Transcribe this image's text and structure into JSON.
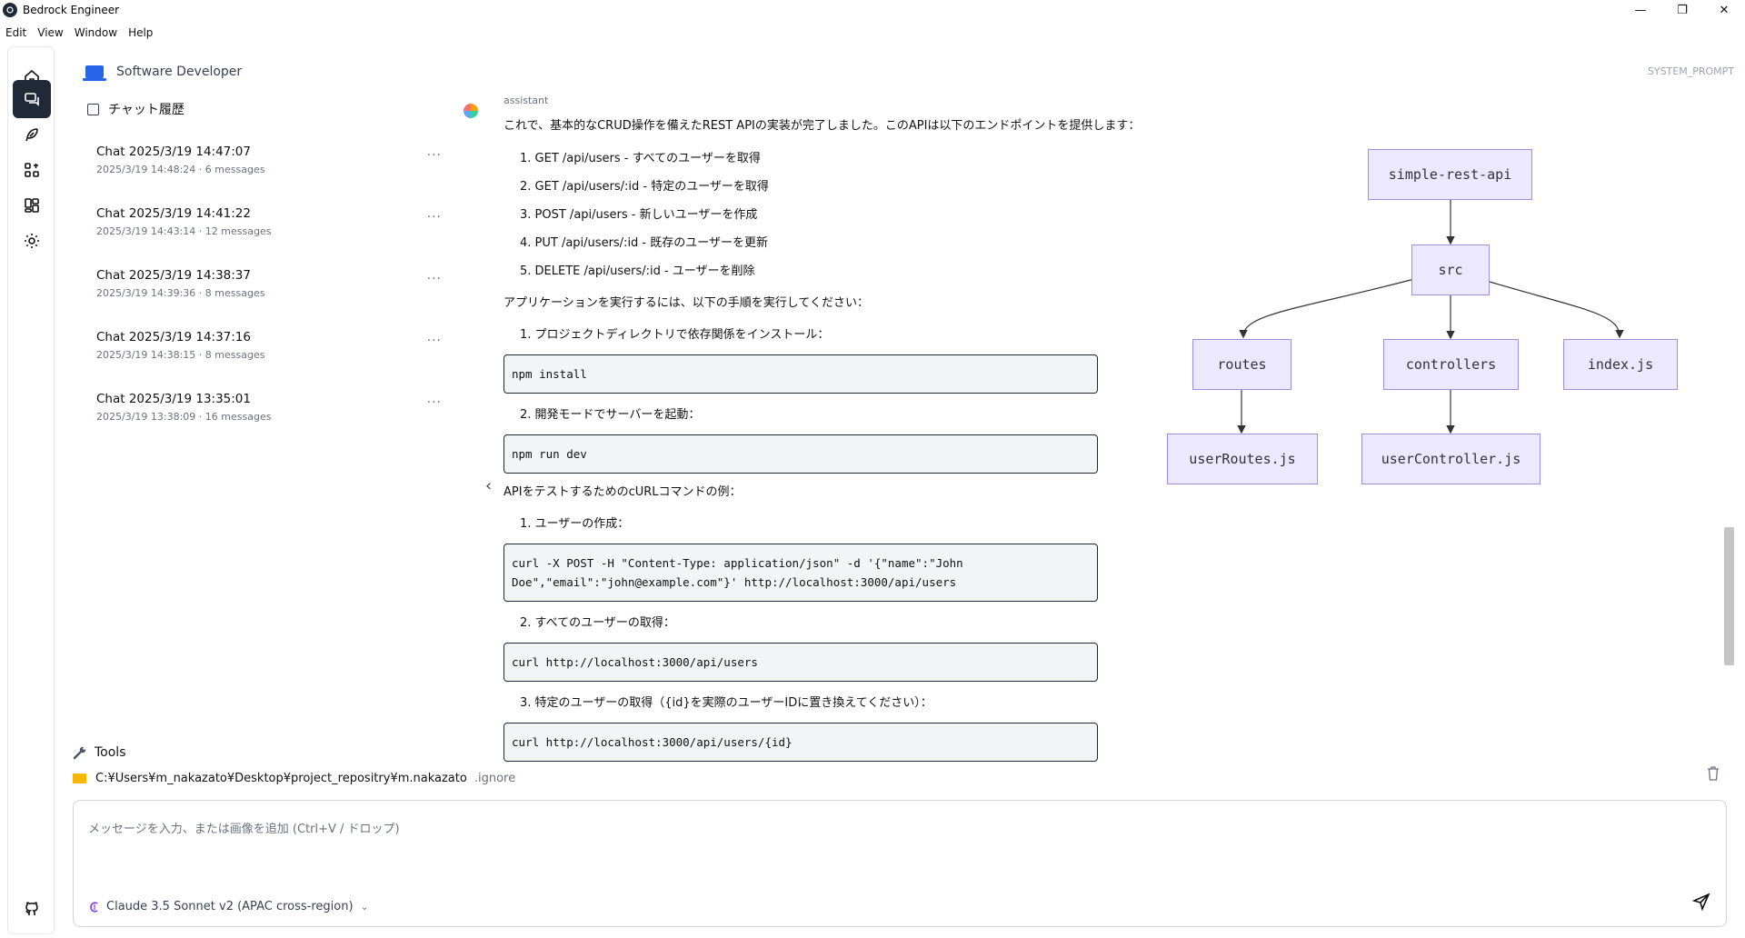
{
  "window": {
    "title": "Bedrock Engineer",
    "minimize": "—",
    "maximize": "❐",
    "close": "✕"
  },
  "menu": [
    "Edit",
    "View",
    "Window",
    "Help"
  ],
  "rail": [
    "home-icon",
    "chat-icon",
    "feather-icon",
    "agents-icon",
    "layout-icon",
    "settings-icon",
    "github-icon"
  ],
  "sidebar": {
    "persona": "Software Developer",
    "history_label": "チャット履歴",
    "chats": [
      {
        "title": "Chat 2025/3/19 14:47:07",
        "sub": "2025/3/19 14:48:24 · 6 messages"
      },
      {
        "title": "Chat 2025/3/19 14:41:22",
        "sub": "2025/3/19 14:43:14 · 12 messages"
      },
      {
        "title": "Chat 2025/3/19 14:38:37",
        "sub": "2025/3/19 14:39:36 · 8 messages"
      },
      {
        "title": "Chat 2025/3/19 14:37:16",
        "sub": "2025/3/19 14:38:15 · 8 messages"
      },
      {
        "title": "Chat 2025/3/19 13:35:01",
        "sub": "2025/3/19 13:38:09 · 16 messages"
      }
    ],
    "more": "···",
    "collapse": "‹"
  },
  "system_prompt": "SYSTEM_PROMPT",
  "message": {
    "role": "assistant",
    "intro": "これで、基本的なCRUD操作を備えたREST APIの実装が完了しました。このAPIは以下のエンドポイントを提供します：",
    "endpoints": [
      "1. GET /api/users - すべてのユーザーを取得",
      "2. GET /api/users/:id - 特定のユーザーを取得",
      "3. POST /api/users - 新しいユーザーを作成",
      "4. PUT /api/users/:id - 既存のユーザーを更新",
      "5. DELETE /api/users/:id - ユーザーを削除"
    ],
    "run_intro": "アプリケーションを実行するには、以下の手順を実行してください：",
    "step1": "1. プロジェクトディレクトリで依存関係をインストール：",
    "code1": "npm install",
    "step2": "2. 開発モードでサーバーを起動：",
    "code2": "npm run dev",
    "curl_intro": "APIをテストするためのcURLコマンドの例：",
    "c1": "1. ユーザーの作成：",
    "code3": "curl -X POST -H \"Content-Type: application/json\" -d '{\"name\":\"John\nDoe\",\"email\":\"john@example.com\"}' http://localhost:3000/api/users",
    "c2": "2. すべてのユーザーの取得：",
    "code4": "curl http://localhost:3000/api/users",
    "c3": "3. 特定のユーザーの取得（{id}を実際のユーザーIDに置き換えてください）：",
    "code5": "curl http://localhost:3000/api/users/{id}"
  },
  "diagram": {
    "root": "simple-rest-api",
    "src": "src",
    "routes": "routes",
    "controllers": "controllers",
    "index": "index.js",
    "userRoutes": "userRoutes.js",
    "userController": "userController.js"
  },
  "footer": {
    "tools": "Tools",
    "path": "C:¥Users¥m_nakazato¥Desktop¥project_repositry¥m.nakazato",
    "ignore": ".ignore"
  },
  "composer": {
    "placeholder": "メッセージを入力、または画像を追加 (Ctrl+V / ドロップ)",
    "model": "Claude 3.5 Sonnet v2 (APAC cross-region)",
    "model_chevron": "⌄"
  }
}
